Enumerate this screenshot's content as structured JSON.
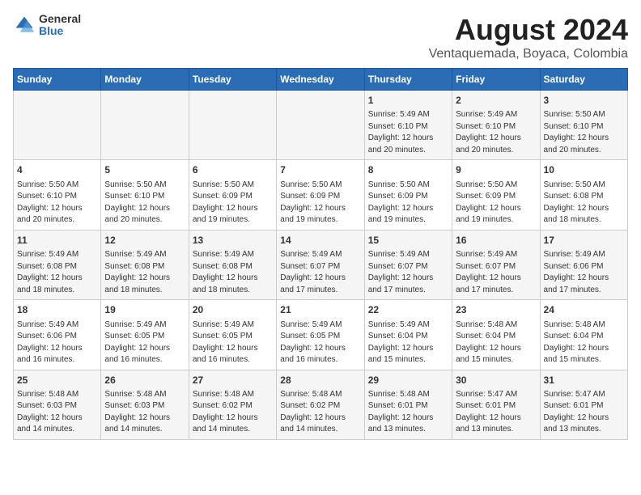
{
  "logo": {
    "general": "General",
    "blue": "Blue"
  },
  "title": "August 2024",
  "subtitle": "Ventaquemada, Boyaca, Colombia",
  "days_of_week": [
    "Sunday",
    "Monday",
    "Tuesday",
    "Wednesday",
    "Thursday",
    "Friday",
    "Saturday"
  ],
  "weeks": [
    [
      {
        "day": "",
        "info": ""
      },
      {
        "day": "",
        "info": ""
      },
      {
        "day": "",
        "info": ""
      },
      {
        "day": "",
        "info": ""
      },
      {
        "day": "1",
        "info": "Sunrise: 5:49 AM\nSunset: 6:10 PM\nDaylight: 12 hours\nand 20 minutes."
      },
      {
        "day": "2",
        "info": "Sunrise: 5:49 AM\nSunset: 6:10 PM\nDaylight: 12 hours\nand 20 minutes."
      },
      {
        "day": "3",
        "info": "Sunrise: 5:50 AM\nSunset: 6:10 PM\nDaylight: 12 hours\nand 20 minutes."
      }
    ],
    [
      {
        "day": "4",
        "info": "Sunrise: 5:50 AM\nSunset: 6:10 PM\nDaylight: 12 hours\nand 20 minutes."
      },
      {
        "day": "5",
        "info": "Sunrise: 5:50 AM\nSunset: 6:10 PM\nDaylight: 12 hours\nand 20 minutes."
      },
      {
        "day": "6",
        "info": "Sunrise: 5:50 AM\nSunset: 6:09 PM\nDaylight: 12 hours\nand 19 minutes."
      },
      {
        "day": "7",
        "info": "Sunrise: 5:50 AM\nSunset: 6:09 PM\nDaylight: 12 hours\nand 19 minutes."
      },
      {
        "day": "8",
        "info": "Sunrise: 5:50 AM\nSunset: 6:09 PM\nDaylight: 12 hours\nand 19 minutes."
      },
      {
        "day": "9",
        "info": "Sunrise: 5:50 AM\nSunset: 6:09 PM\nDaylight: 12 hours\nand 19 minutes."
      },
      {
        "day": "10",
        "info": "Sunrise: 5:50 AM\nSunset: 6:08 PM\nDaylight: 12 hours\nand 18 minutes."
      }
    ],
    [
      {
        "day": "11",
        "info": "Sunrise: 5:49 AM\nSunset: 6:08 PM\nDaylight: 12 hours\nand 18 minutes."
      },
      {
        "day": "12",
        "info": "Sunrise: 5:49 AM\nSunset: 6:08 PM\nDaylight: 12 hours\nand 18 minutes."
      },
      {
        "day": "13",
        "info": "Sunrise: 5:49 AM\nSunset: 6:08 PM\nDaylight: 12 hours\nand 18 minutes."
      },
      {
        "day": "14",
        "info": "Sunrise: 5:49 AM\nSunset: 6:07 PM\nDaylight: 12 hours\nand 17 minutes."
      },
      {
        "day": "15",
        "info": "Sunrise: 5:49 AM\nSunset: 6:07 PM\nDaylight: 12 hours\nand 17 minutes."
      },
      {
        "day": "16",
        "info": "Sunrise: 5:49 AM\nSunset: 6:07 PM\nDaylight: 12 hours\nand 17 minutes."
      },
      {
        "day": "17",
        "info": "Sunrise: 5:49 AM\nSunset: 6:06 PM\nDaylight: 12 hours\nand 17 minutes."
      }
    ],
    [
      {
        "day": "18",
        "info": "Sunrise: 5:49 AM\nSunset: 6:06 PM\nDaylight: 12 hours\nand 16 minutes."
      },
      {
        "day": "19",
        "info": "Sunrise: 5:49 AM\nSunset: 6:05 PM\nDaylight: 12 hours\nand 16 minutes."
      },
      {
        "day": "20",
        "info": "Sunrise: 5:49 AM\nSunset: 6:05 PM\nDaylight: 12 hours\nand 16 minutes."
      },
      {
        "day": "21",
        "info": "Sunrise: 5:49 AM\nSunset: 6:05 PM\nDaylight: 12 hours\nand 16 minutes."
      },
      {
        "day": "22",
        "info": "Sunrise: 5:49 AM\nSunset: 6:04 PM\nDaylight: 12 hours\nand 15 minutes."
      },
      {
        "day": "23",
        "info": "Sunrise: 5:48 AM\nSunset: 6:04 PM\nDaylight: 12 hours\nand 15 minutes."
      },
      {
        "day": "24",
        "info": "Sunrise: 5:48 AM\nSunset: 6:04 PM\nDaylight: 12 hours\nand 15 minutes."
      }
    ],
    [
      {
        "day": "25",
        "info": "Sunrise: 5:48 AM\nSunset: 6:03 PM\nDaylight: 12 hours\nand 14 minutes."
      },
      {
        "day": "26",
        "info": "Sunrise: 5:48 AM\nSunset: 6:03 PM\nDaylight: 12 hours\nand 14 minutes."
      },
      {
        "day": "27",
        "info": "Sunrise: 5:48 AM\nSunset: 6:02 PM\nDaylight: 12 hours\nand 14 minutes."
      },
      {
        "day": "28",
        "info": "Sunrise: 5:48 AM\nSunset: 6:02 PM\nDaylight: 12 hours\nand 14 minutes."
      },
      {
        "day": "29",
        "info": "Sunrise: 5:48 AM\nSunset: 6:01 PM\nDaylight: 12 hours\nand 13 minutes."
      },
      {
        "day": "30",
        "info": "Sunrise: 5:47 AM\nSunset: 6:01 PM\nDaylight: 12 hours\nand 13 minutes."
      },
      {
        "day": "31",
        "info": "Sunrise: 5:47 AM\nSunset: 6:01 PM\nDaylight: 12 hours\nand 13 minutes."
      }
    ]
  ]
}
